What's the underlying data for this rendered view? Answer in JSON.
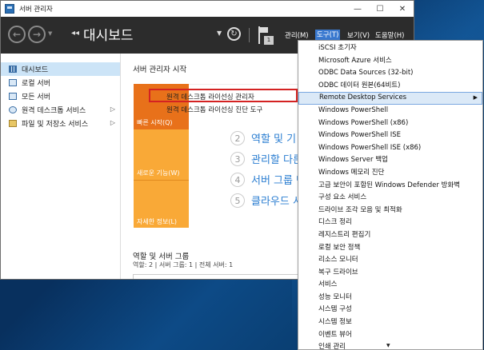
{
  "window": {
    "title": "서버 관리자",
    "controls": {
      "minimize": "—",
      "maximize": "☐",
      "close": "✕"
    }
  },
  "header": {
    "breadcrumb_arrows": "◂◂",
    "page_title": "대시보드",
    "notification_count": "1",
    "menus": [
      {
        "label": "관리(M)"
      },
      {
        "label": "도구(T)"
      },
      {
        "label": "보기(V)"
      },
      {
        "label": "도움말(H)"
      }
    ]
  },
  "sidebar": {
    "items": [
      {
        "label": "대시보드",
        "selected": true
      },
      {
        "label": "로컬 서버"
      },
      {
        "label": "모든 서버"
      },
      {
        "label": "원격 데스크톱 서비스",
        "has_children": true
      },
      {
        "label": "파일 및 저장소 서비스",
        "has_children": true
      }
    ]
  },
  "main": {
    "section_title": "서버 관리자 시작",
    "quick_start_label": "빠른 시작(Q)",
    "whats_new_label": "새로운 기능(W)",
    "learn_more_label": "자세한 정보(L)",
    "links": [
      "원격 데스크톱 라이선싱 관리자",
      "원격 데스크톱 라이선싱 진단 도구"
    ],
    "steps": [
      {
        "num": "2",
        "label": "역할 및 기"
      },
      {
        "num": "3",
        "label": "관리할 다른"
      },
      {
        "num": "4",
        "label": "서버 그룹 만"
      },
      {
        "num": "5",
        "label": "클라우드 서"
      }
    ],
    "roles_title": "역할 및 서버 그룹",
    "roles_stats": "역할: 2   |   서버 그룹: 1   |   전체 서버: 1"
  },
  "tools_menu": {
    "items": [
      {
        "label": "iSCSI 초기자"
      },
      {
        "label": "Microsoft Azure 서비스"
      },
      {
        "label": "ODBC Data Sources (32-bit)"
      },
      {
        "label": "ODBC 데이터 원본(64비트)"
      },
      {
        "label": "Remote Desktop Services",
        "submenu": true,
        "hover": true
      },
      {
        "label": "Windows PowerShell"
      },
      {
        "label": "Windows PowerShell (x86)"
      },
      {
        "label": "Windows PowerShell ISE"
      },
      {
        "label": "Windows PowerShell ISE (x86)"
      },
      {
        "label": "Windows Server 백업"
      },
      {
        "label": "Windows 메모리 진단"
      },
      {
        "label": "고급 보안이 포함된 Windows Defender 방화벽"
      },
      {
        "label": "구성 요소 서비스"
      },
      {
        "label": "드라이브 조각 모음 및 최적화"
      },
      {
        "label": "디스크 정리"
      },
      {
        "label": "레지스트리 편집기"
      },
      {
        "label": "로컬 보안 정책"
      },
      {
        "label": "리소스 모니터"
      },
      {
        "label": "복구 드라이브"
      },
      {
        "label": "서비스"
      },
      {
        "label": "성능 모니터"
      },
      {
        "label": "시스템 구성"
      },
      {
        "label": "시스템 정보"
      },
      {
        "label": "이벤트 뷰어"
      },
      {
        "label": "인쇄 관리"
      }
    ]
  },
  "colors": {
    "header_bg": "#2c2c2c",
    "accent_blue": "#3b7ad0",
    "quick_start": "#e8711a",
    "tile_orange": "#f9a937",
    "link_blue": "#2a7dd1",
    "highlight_red": "#d42222"
  }
}
